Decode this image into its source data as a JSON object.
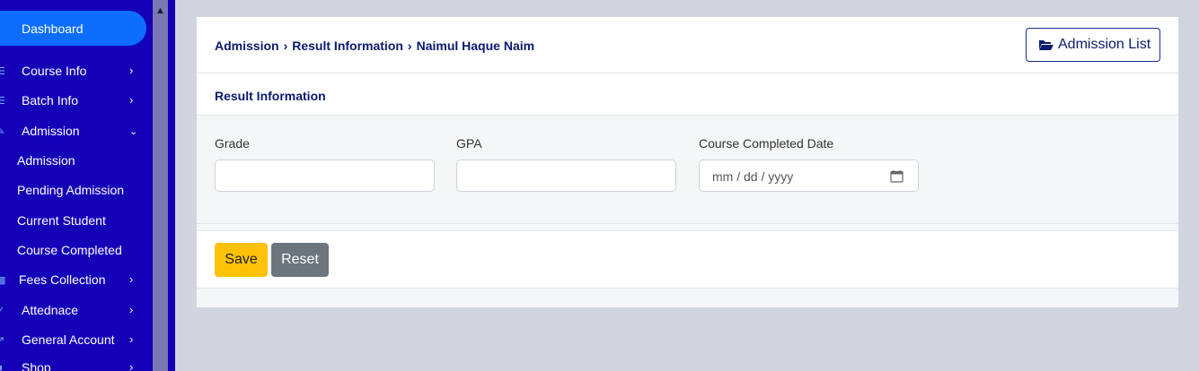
{
  "sidebar": {
    "dashboard": "Dashboard",
    "items": [
      {
        "label": "Course Info",
        "icon": "list-icon"
      },
      {
        "label": "Batch Info",
        "icon": "layers-icon"
      },
      {
        "label": "Admission",
        "icon": "edit-icon"
      },
      {
        "label": "Fees Collection",
        "icon": "money-icon"
      },
      {
        "label": "Attednace",
        "icon": "check-circle-icon"
      },
      {
        "label": "General Account",
        "icon": "chart-icon"
      },
      {
        "label": "Shop",
        "icon": "shop-icon"
      }
    ],
    "admission_sub": [
      "Admission",
      "Pending Admission",
      "Current Student",
      "Course Completed"
    ]
  },
  "header": {
    "breadcrumb": [
      "Admission",
      "Result Information",
      "Naimul Haque Naim"
    ],
    "admission_list_label": "Admission List"
  },
  "section": {
    "title": "Result Information"
  },
  "form": {
    "grade_label": "Grade",
    "grade_value": "",
    "gpa_label": "GPA",
    "gpa_value": "",
    "date_label": "Course Completed Date",
    "date_placeholder": "mm / dd / yyyy"
  },
  "actions": {
    "save_label": "Save",
    "reset_label": "Reset"
  },
  "colors": {
    "sidebar_bg": "#1500b8",
    "active_pill": "#0d6efd",
    "save": "#ffc107",
    "reset": "#6c757d",
    "heading_text": "#0a1a6e",
    "page_bg": "#d1d5e0"
  }
}
